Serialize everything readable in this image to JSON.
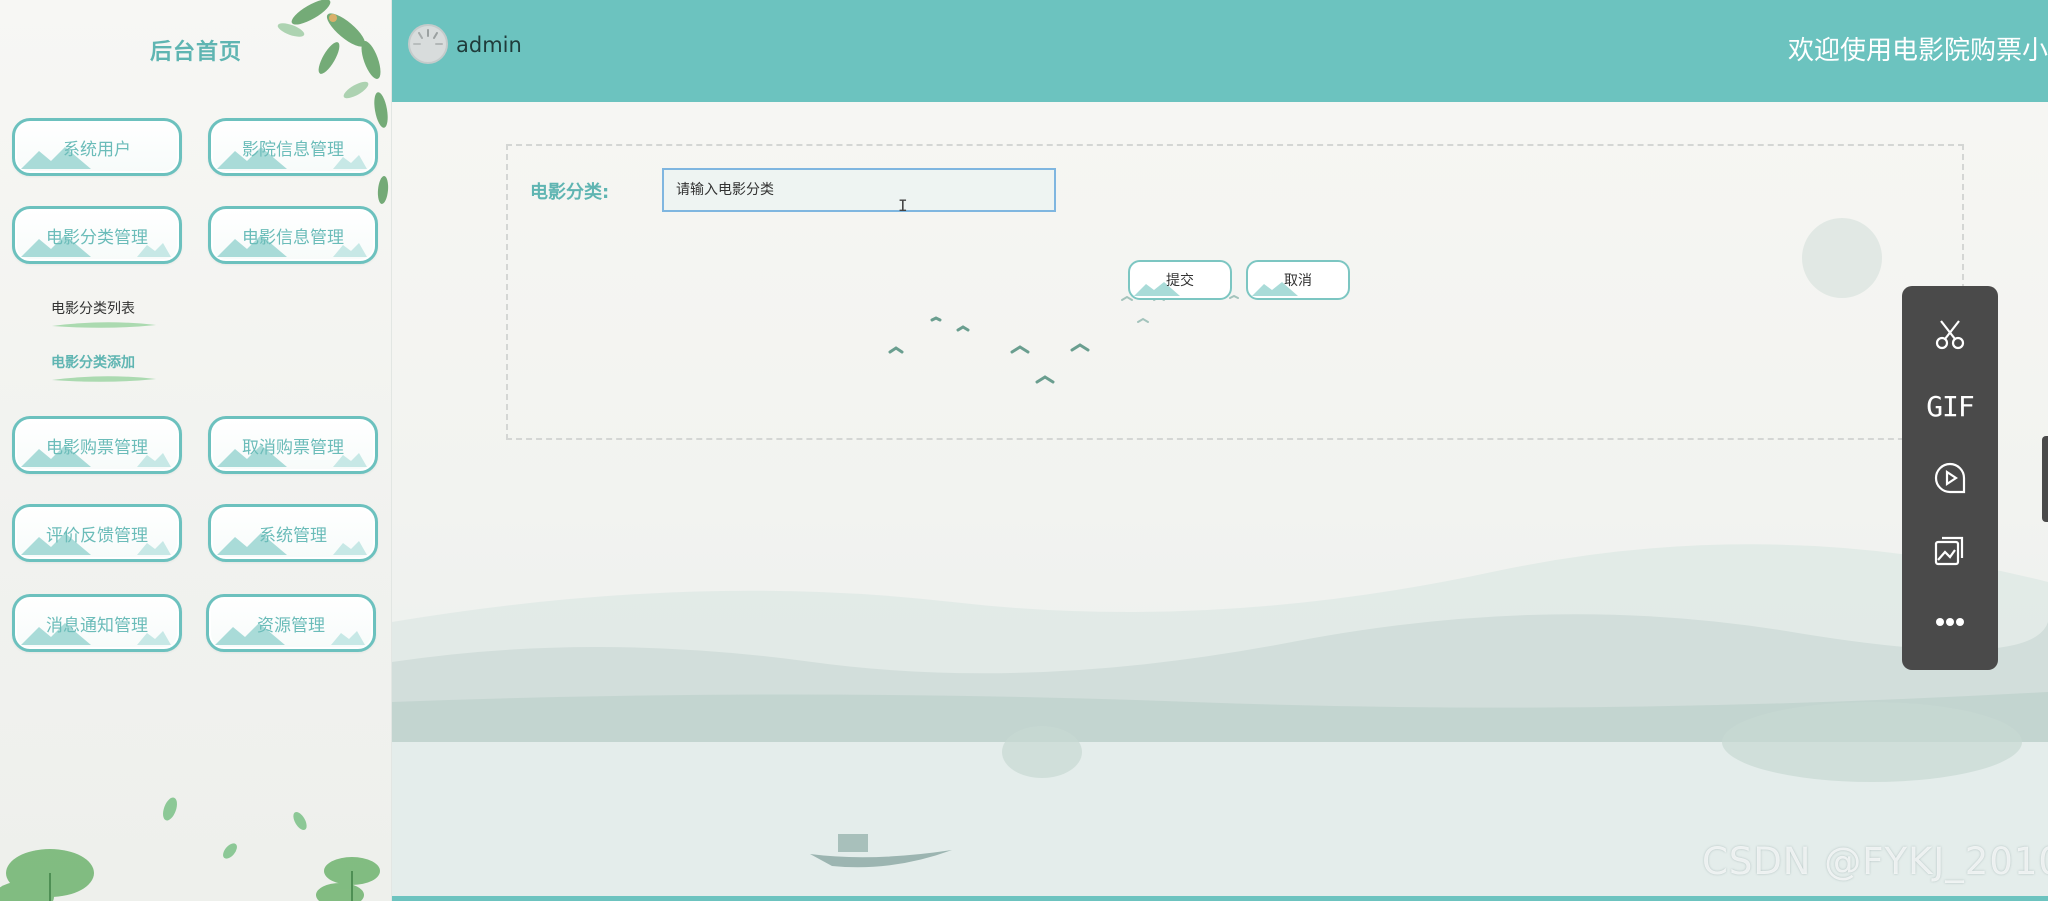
{
  "sidebar": {
    "title": "后台首页",
    "menu": [
      {
        "label": "系统用户"
      },
      {
        "label": "影院信息管理"
      },
      {
        "label": "电影分类管理"
      },
      {
        "label": "电影信息管理"
      },
      {
        "label": "电影购票管理"
      },
      {
        "label": "取消购票管理"
      },
      {
        "label": "评价反馈管理"
      },
      {
        "label": "系统管理"
      },
      {
        "label": "消息通知管理"
      },
      {
        "label": "资源管理"
      }
    ],
    "submenu": [
      {
        "label": "电影分类列表",
        "active": false
      },
      {
        "label": "电影分类添加",
        "active": true
      }
    ]
  },
  "header": {
    "username": "admin",
    "welcome": "欢迎使用电影院购票小程"
  },
  "form": {
    "field_label": "电影分类:",
    "field_placeholder": "请输入电影分类",
    "field_value": "",
    "submit_label": "提交",
    "cancel_label": "取消"
  },
  "floatbar": {
    "tools": [
      "scissors-icon",
      "gif-icon",
      "record-icon",
      "image-icon",
      "more-icon"
    ],
    "gif_text": "GIF"
  },
  "watermark": "CSDN @FYKJ_2010",
  "colors": {
    "accent": "#6cc3bf",
    "accent_text": "#5fb5b2",
    "toolbar_bg": "#4a4a4a",
    "input_border": "#7fb6e0"
  }
}
